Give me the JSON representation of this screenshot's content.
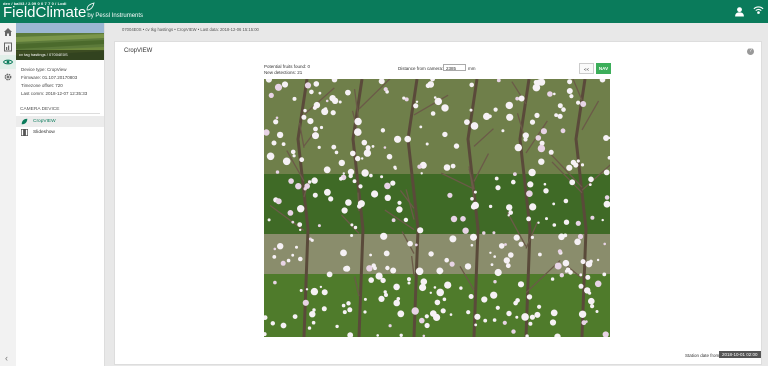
{
  "header": {
    "crumb": "dev / kalli3 / 2.09 0 0 7 7 0 / Lodi",
    "logo_main": "FieldClimate",
    "logo_by": "by Pessl Instruments"
  },
  "colors": {
    "brand": "#0a7b5b",
    "accent": "#3cae5a",
    "badge": "#555555"
  },
  "rail": {
    "icons": [
      "home-icon",
      "station-icon",
      "eye-icon",
      "gear-icon"
    ],
    "collapse": "‹"
  },
  "sidebar": {
    "station_name": "cv tag hastings / 07004E0S",
    "info": [
      "Device type: CropView",
      "Firmware: 01.107.20170803",
      "Timezone offset: 720",
      "Last comm: 2018-12-07 12:35:33"
    ],
    "section_title": "CAMERA DEVICE",
    "items": [
      {
        "label": "CropVIEW",
        "icon": "leaf-icon"
      },
      {
        "label": "Slideshow",
        "icon": "film-icon"
      }
    ]
  },
  "breadcrumb": "07004E0S  •  cv tkg hastings  •  CropVIEW  •  Last data: 2018-12-06 15:15:00",
  "main": {
    "title": "CropVIEW",
    "help": "?",
    "fruits_found": "Potential fruits found: 0",
    "new_detections": "New detections: 21",
    "distance_label": "Distance from camera:",
    "distance_value": "2385",
    "distance_unit": "mm",
    "zoom_out_label": "<<",
    "zoom_in_label": "NAV",
    "station_date_label": "Station date from:",
    "station_date_value": "2018-10-01 02:00"
  }
}
